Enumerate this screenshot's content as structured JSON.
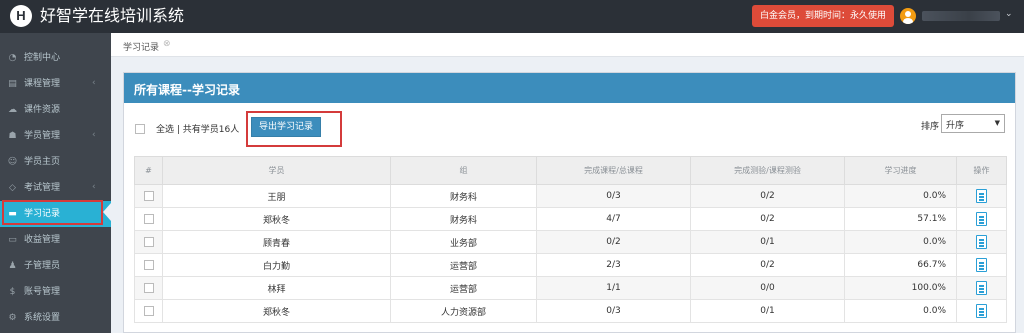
{
  "header": {
    "logo_letter": "H",
    "app_title": "好智学在线培训系统",
    "member_badge": "白金会员，到期时间：永久使用",
    "user_caret": "⌄"
  },
  "sidebar": {
    "items": [
      {
        "label": "控制中心",
        "icon": "dashboard-icon",
        "glyph": "◔",
        "has_submenu": false
      },
      {
        "label": "课程管理",
        "icon": "book-icon",
        "glyph": "▤",
        "has_submenu": true
      },
      {
        "label": "课件资源",
        "icon": "cloud-icon",
        "glyph": "☁",
        "has_submenu": false
      },
      {
        "label": "学员管理",
        "icon": "users-icon",
        "glyph": "☗",
        "has_submenu": true
      },
      {
        "label": "学员主页",
        "icon": "user-icon",
        "glyph": "☺",
        "has_submenu": false
      },
      {
        "label": "考试管理",
        "icon": "tag-icon",
        "glyph": "◇",
        "has_submenu": true
      },
      {
        "label": "学习记录",
        "icon": "folder-icon",
        "glyph": "▬",
        "has_submenu": false,
        "active": true
      },
      {
        "label": "收益管理",
        "icon": "card-icon",
        "glyph": "▭",
        "has_submenu": false
      },
      {
        "label": "子管理员",
        "icon": "person-icon",
        "glyph": "♟",
        "has_submenu": false
      },
      {
        "label": "账号管理",
        "icon": "dollar-icon",
        "glyph": "$",
        "has_submenu": false
      },
      {
        "label": "系统设置",
        "icon": "gear-icon",
        "glyph": "⚙",
        "has_submenu": false
      }
    ],
    "chevron": "‹"
  },
  "breadcrumb": {
    "current": "学习记录",
    "close": "⊗"
  },
  "panel": {
    "title": "所有课程--学习记录",
    "select_all": "全选 | 共有学员16人",
    "export_button": "导出学习记录",
    "sort_label": "排序",
    "sort_value": "升序",
    "sort_arrow": "▼"
  },
  "table": {
    "headers": [
      "#",
      "学员",
      "组",
      "完成课程/总课程",
      "完成测验/课程测验",
      "学习进度",
      "操作"
    ],
    "rows": [
      {
        "name": "王朋",
        "group": "财务科",
        "courses": "0/3",
        "quizzes": "0/2",
        "progress": "0.0%"
      },
      {
        "name": "郑秋冬",
        "group": "财务科",
        "courses": "4/7",
        "quizzes": "0/2",
        "progress": "57.1%"
      },
      {
        "name": "顾青春",
        "group": "业务部",
        "courses": "0/2",
        "quizzes": "0/1",
        "progress": "0.0%"
      },
      {
        "name": "白力勤",
        "group": "运营部",
        "courses": "2/3",
        "quizzes": "0/2",
        "progress": "66.7%"
      },
      {
        "name": "林拜",
        "group": "运营部",
        "courses": "1/1",
        "quizzes": "0/0",
        "progress": "100.0%"
      },
      {
        "name": "郑秋冬",
        "group": "人力资源部",
        "courses": "0/3",
        "quizzes": "0/1",
        "progress": "0.0%"
      }
    ],
    "action_icon": "clipboard-icon"
  },
  "colors": {
    "topbar": "#2b3037",
    "sidebar": "#3f454d",
    "active_item": "#29b1d4",
    "panel_header": "#3c8dbc",
    "badge": "#dd4b39",
    "highlight_outline": "#d43b3b"
  }
}
